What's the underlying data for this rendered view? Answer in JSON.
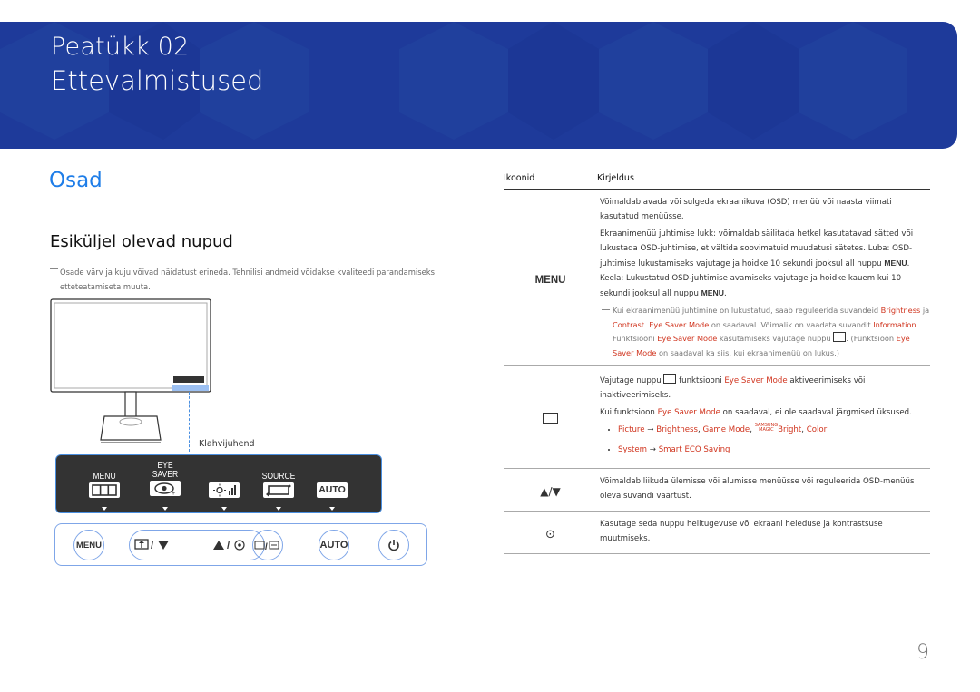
{
  "banner": {
    "chapter_label": "Peatükk  02",
    "chapter_title": "Ettevalmistused"
  },
  "section_title": "Osad",
  "subsection_title": "Esiküljel olevad nupud",
  "note": {
    "line1": "Osade värv ja kuju võivad näidatust erineda. Tehnilisi andmeid võidakse kvaliteedi parandamiseks",
    "line2": "etteteatamiseta muuta."
  },
  "diagram": {
    "guide_label": "Klahvijuhend",
    "panel_buttons": [
      {
        "top": "",
        "label": "MENU",
        "icon": "menu-grid-icon"
      },
      {
        "top": "EYE",
        "label": "SAVER",
        "icon": "eye-saver-icon"
      },
      {
        "top": "",
        "label": "",
        "icon": "brightness-contrast-icon"
      },
      {
        "top": "",
        "label": "SOURCE",
        "icon": "source-icon"
      },
      {
        "top": "",
        "label": "",
        "icon": "auto-icon",
        "icon_text": "AUTO"
      }
    ],
    "bottom_buttons": {
      "menu": "MENU",
      "pill_left_sep": "/",
      "pill_right_sep": "/",
      "source_sep": "/",
      "auto": "AUTO"
    }
  },
  "table": {
    "headers": {
      "icons": "Ikoonid",
      "description": "Kirjeldus"
    },
    "rows": {
      "menu": {
        "icon_label": "MENU",
        "p1": "Võimaldab avada või sulgeda ekraanikuva (OSD) menüü või naasta viimati kasutatud menüüsse.",
        "p2a": "Ekraanimenüü juhtimise lukk: võimaldab säilitada hetkel kasutatavad sätted või lukustada OSD-juhtimise, et vältida soovimatuid muudatusi sätetes. Luba: OSD-juhtimise lukustamiseks vajutage ja hoidke 10 sekundi jooksul all nuppu ",
        "p2b": "MENU",
        "p2c": ". Keela: Lukustatud OSD-juhtimise avamiseks vajutage ja hoidke kauem kui 10 sekundi jooksul all nuppu ",
        "p2d": "MENU",
        "p2e": ".",
        "note_a": "Kui ekraanimenüü juhtimine on lukustatud, saab reguleerida suvandeid ",
        "note_brightness": "Brightness",
        "note_ja": " ja ",
        "note_contrast": "Contrast",
        "note_dot": ". ",
        "note_esm": "Eye Saver Mode",
        "note_b": " on saadaval. Võimalik on vaadata suvandit ",
        "note_info": "Information",
        "note_end": ".",
        "note2_a": "Funktsiooni ",
        "note2_esm": "Eye Saver Mode",
        "note2_b": " kasutamiseks vajutage nuppu ",
        "note2_c": ". (Funktsioon ",
        "note2_esm2": "Eye Saver Mode",
        "note2_d": " on saadaval ka siis, kui ekraanimenüü on lukus.)"
      },
      "eye": {
        "p1a": "Vajutage nuppu ",
        "p1b": " funktsiooni ",
        "p1esm": "Eye Saver Mode",
        "p1c": " aktiveerimiseks või inaktiveerimiseks.",
        "p2a": "Kui funktsioon ",
        "p2esm": "Eye Saver Mode",
        "p2b": " on saadaval, ei ole saadaval järgmised üksused.",
        "bullet1": {
          "picture": "Picture",
          "arrow": " → ",
          "brightness": "Brightness",
          "game": "Game Mode",
          "magic_top": "SAMSUNG",
          "magic_bot": "MAGIC",
          "bright": "Bright",
          "color": "Color",
          "comma": ", "
        },
        "bullet2": {
          "system": "System",
          "arrow": " → ",
          "eco": "Smart ECO Saving"
        }
      },
      "updown": {
        "icon_label": "▲/▼",
        "text": "Võimaldab liikuda ülemisse või alumisse menüüsse või reguleerida OSD-menüüs oleva suvandi väärtust."
      },
      "enter": {
        "icon_label": "⊙",
        "text": "Kasutage seda nuppu helitugevuse või ekraani heleduse ja kontrastsuse muutmiseks."
      }
    }
  },
  "page_number": "9",
  "colors": {
    "banner": "#1e3a9a",
    "accent_blue": "#1e7de8",
    "highlight_red": "#d0341e"
  }
}
